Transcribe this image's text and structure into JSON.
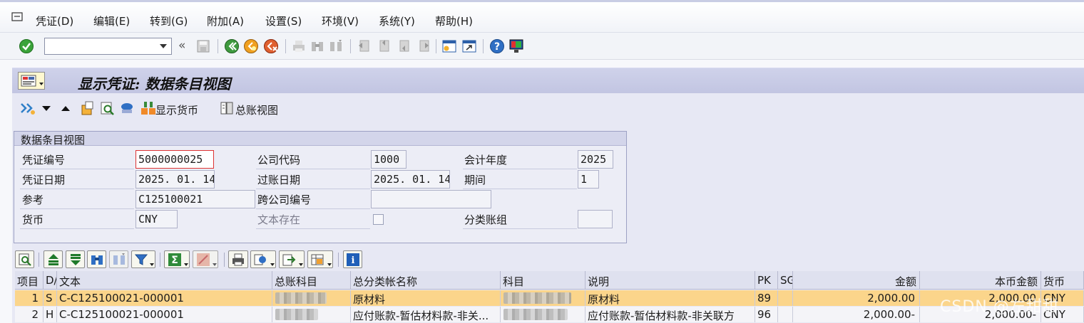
{
  "menu": {
    "items": [
      "凭证(D)",
      "编辑(E)",
      "转到(G)",
      "附加(A)",
      "设置(S)",
      "环境(V)",
      "系统(Y)",
      "帮助(H)"
    ]
  },
  "toolbar": {
    "command_value": "",
    "back_label": "«"
  },
  "title": "显示凭证: 数据条目视图",
  "app_toolbar": {
    "show_currency_label": "显示货币",
    "gl_view_label": "总账视图"
  },
  "groupbox": {
    "title": "数据条目视图",
    "doc_number_label": "凭证编号",
    "doc_number": "5000000025",
    "company_code_label": "公司代码",
    "company_code": "1000",
    "fiscal_year_label": "会计年度",
    "fiscal_year": "2025",
    "doc_date_label": "凭证日期",
    "doc_date": "2025. 01. 14",
    "posting_date_label": "过账日期",
    "posting_date": "2025. 01. 14",
    "period_label": "期间",
    "period": "1",
    "reference_label": "参考",
    "reference": "C125100021",
    "cross_company_label": "跨公司编号",
    "cross_company": "",
    "currency_label": "货币",
    "currency": "CNY",
    "text_exists_label": "文本存在",
    "ledger_group_label": "分类账组",
    "ledger_group": ""
  },
  "table": {
    "columns": [
      "项目",
      "D/",
      "文本",
      "总账科目",
      "总分类帐名称",
      "科目",
      "说明",
      "PK",
      "SG",
      "金额",
      "本币金额",
      "货币"
    ],
    "rows": [
      {
        "item": "1",
        "dc": "S",
        "text": "C-C125100021-000001",
        "gl_name": "原材料",
        "desc": "原材料",
        "pk": "89",
        "sg": "",
        "amount": "2,000.00",
        "local_amount": "2,000.00",
        "currency": "CNY"
      },
      {
        "item": "2",
        "dc": "H",
        "text": "C-C125100021-000001",
        "gl_name": "应付账款-暂估材料款-非关...",
        "desc": "应付账款-暂估材料款-非关联方",
        "pk": "96",
        "sg": "",
        "amount": "2,000.00-",
        "local_amount": "2,000.00-",
        "currency": "CNY"
      }
    ]
  },
  "watermark": "CSDN @左甜甜",
  "colors": {
    "title_bar": "#c2c5e2",
    "selected_row": "#fbd58b",
    "app_background": "#e7e8f4"
  }
}
